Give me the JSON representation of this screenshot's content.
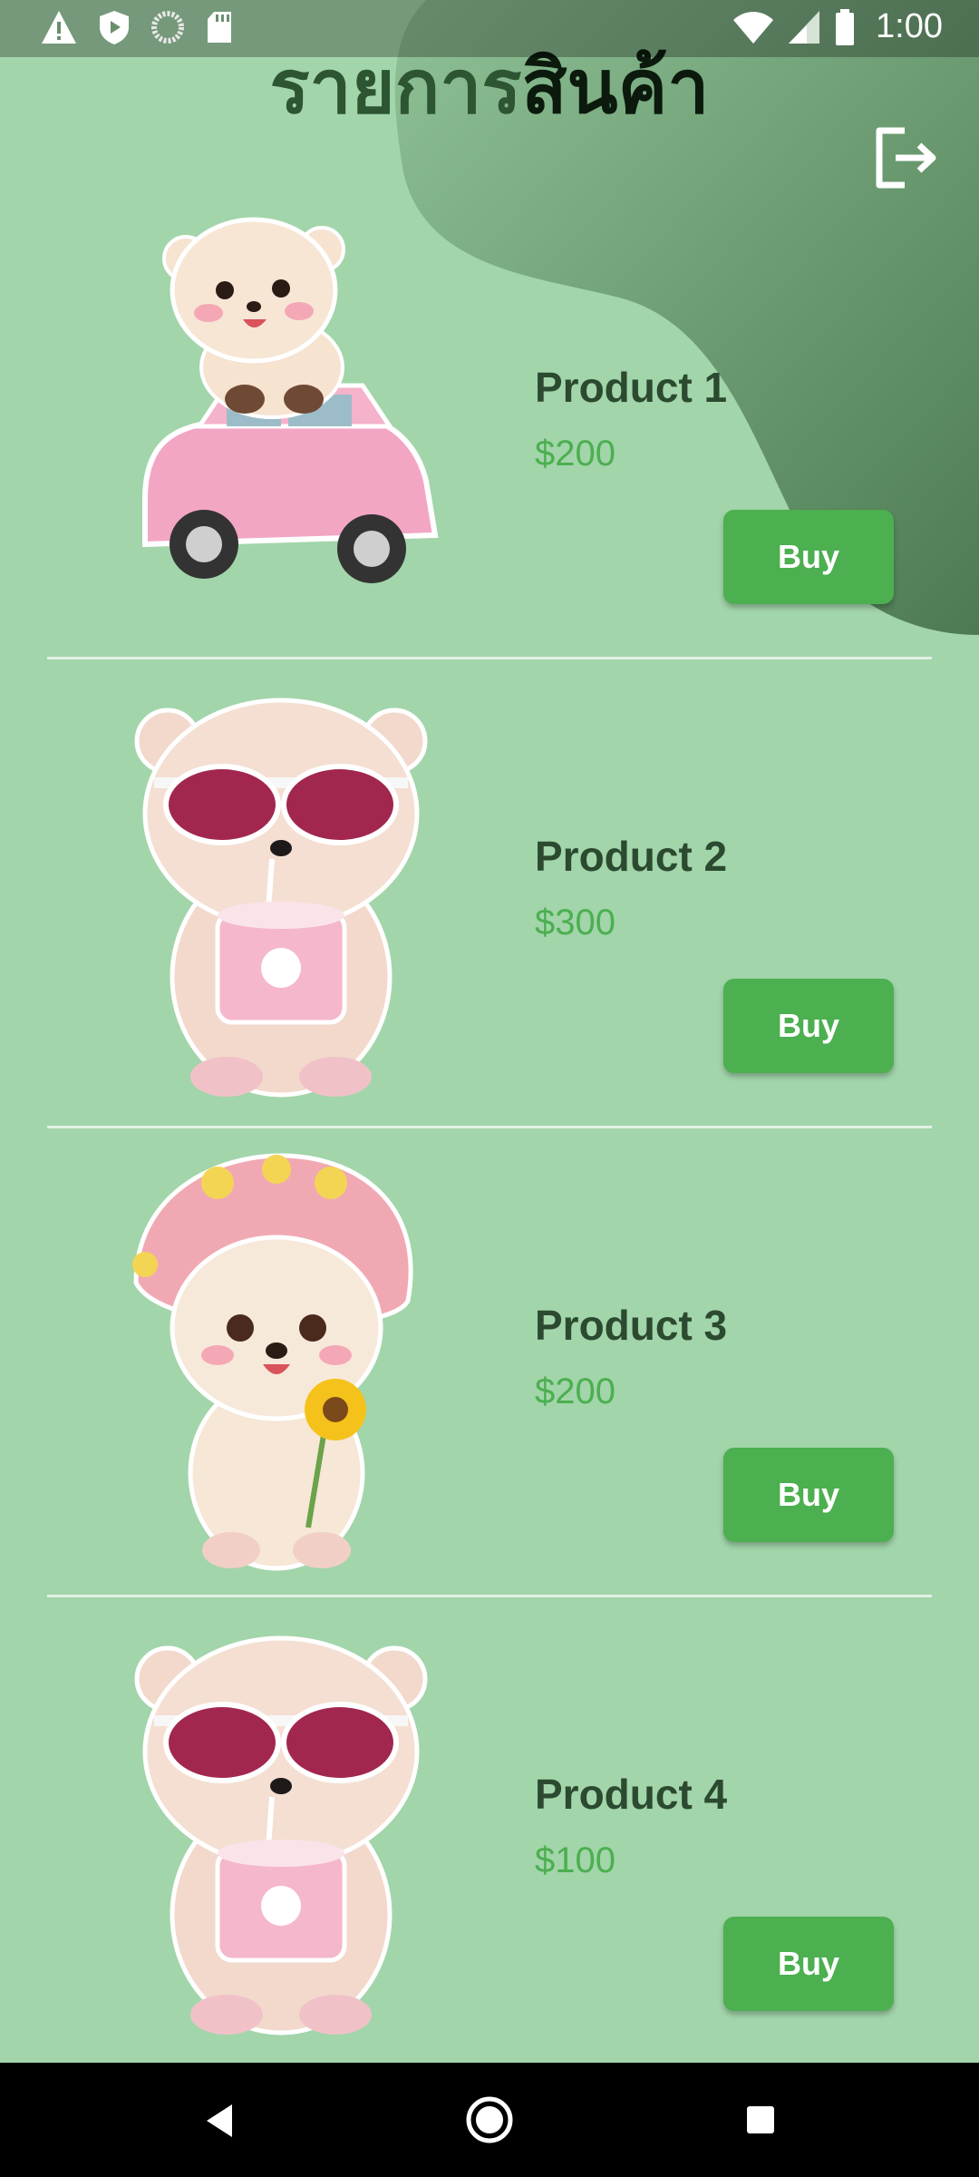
{
  "status_bar": {
    "time": "1:00",
    "icons": [
      "warning-icon",
      "shield-play-icon",
      "loading-icon",
      "sd-card-icon",
      "wifi-icon",
      "signal-icon",
      "battery-icon"
    ]
  },
  "header": {
    "title_part_1": "รายการ",
    "title_part_2": "สินค้า",
    "logout_icon": "logout-icon"
  },
  "products": [
    {
      "name": "Product 1",
      "price": "$200",
      "buy_label": "Buy",
      "image": "bear-on-pink-car"
    },
    {
      "name": "Product 2",
      "price": "$300",
      "buy_label": "Buy",
      "image": "bear-with-sunglasses-and-drink"
    },
    {
      "name": "Product 3",
      "price": "$200",
      "buy_label": "Buy",
      "image": "bear-with-flower-hat-and-sunflower"
    },
    {
      "name": "Product 4",
      "price": "$100",
      "buy_label": "Buy",
      "image": "bear-with-sunglasses-and-drink"
    }
  ],
  "nav_bar": {
    "icons": [
      "back-icon",
      "home-icon",
      "recents-icon"
    ]
  },
  "colors": {
    "background": "#a2d5aa",
    "blob_dark": "#4d7a52",
    "title_dark_green": "#2e5532",
    "title_black": "#0b1a0d",
    "product_name": "#2b4a30",
    "price": "#4caf50",
    "buy_button": "#4caf50",
    "divider": "#e3f0e4"
  }
}
